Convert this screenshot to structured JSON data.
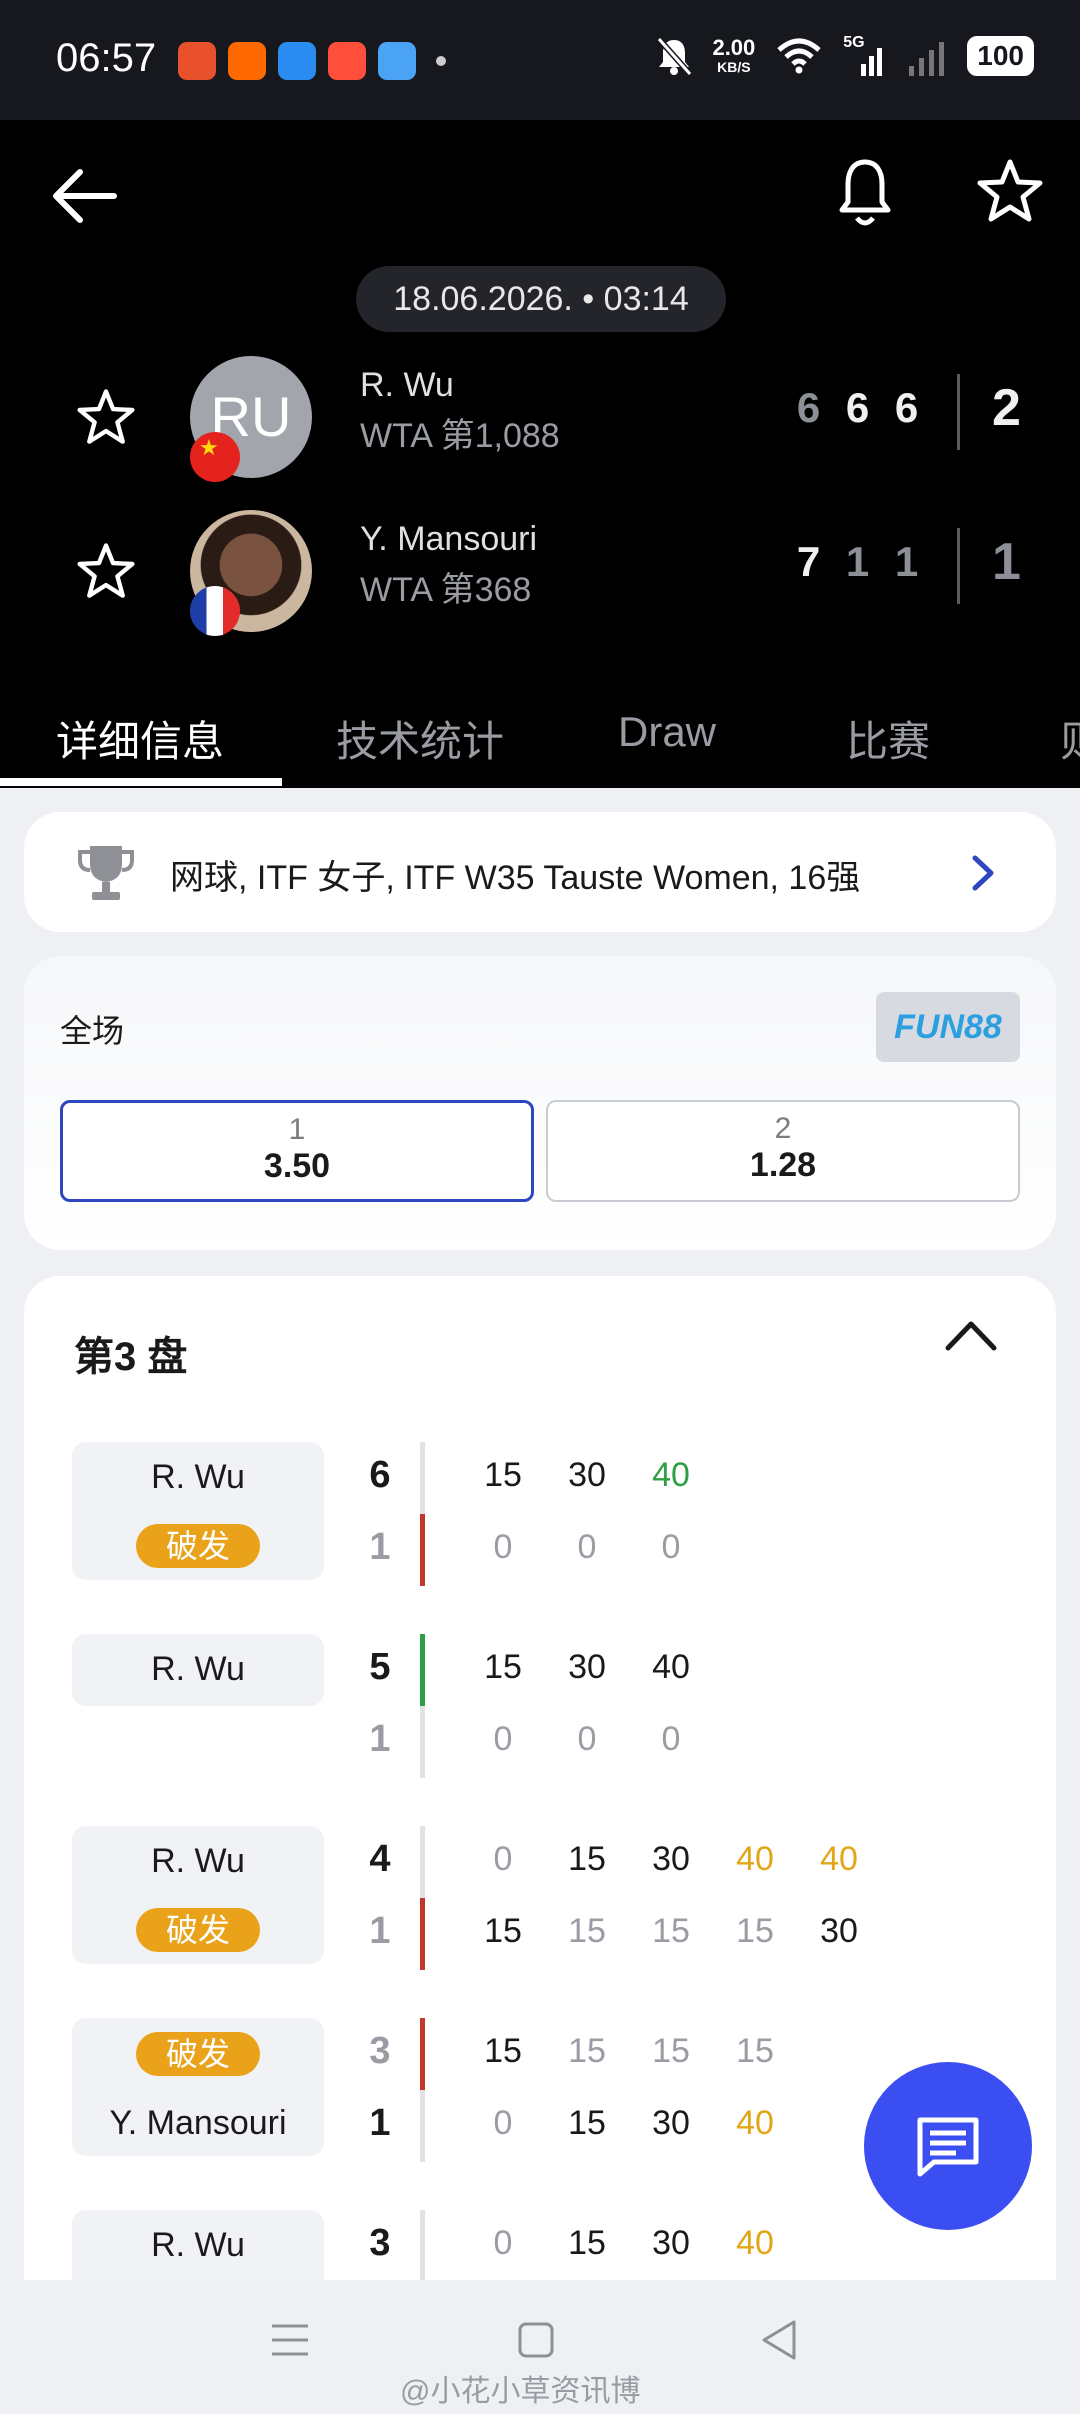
{
  "status_bar": {
    "time": "06:57",
    "speed_value": "2.00",
    "speed_unit": "KB/S",
    "network": "5G",
    "battery": "100",
    "app_icon_colors": [
      "#e8512c",
      "#ff6a00",
      "#2a8cf0",
      "#ff4e3a",
      "#4ba3f5"
    ]
  },
  "header": {
    "back_icon": "arrow-left-icon",
    "bell_icon": "bell-icon",
    "favorite_icon": "star-outline-icon",
    "match_datetime": "18.06.2026. • 03:14"
  },
  "players": [
    {
      "initials": "RU",
      "name": "R. Wu",
      "rank": "WTA 第1,088",
      "flag": "china-flag-icon",
      "sets": [
        "6",
        "6",
        "6"
      ],
      "total": "2"
    },
    {
      "initials": "",
      "name": "Y. Mansouri",
      "rank": "WTA 第368",
      "flag": "france-flag-icon",
      "sets": [
        "7",
        "1",
        "1"
      ],
      "total": "1"
    }
  ],
  "tabs": [
    "详细信息",
    "技术统计",
    "Draw",
    "比赛",
    "则"
  ],
  "tournament": {
    "text": "网球, ITF 女子, ITF W35 Tauste Women, 16强"
  },
  "odds": {
    "title": "全场",
    "bookmaker": "FUN88",
    "options": [
      {
        "label": "1",
        "value": "3.50"
      },
      {
        "label": "2",
        "value": "1.28"
      }
    ]
  },
  "set_section": {
    "title": "第3 盘",
    "games": [
      {
        "label_top": "R. Wu",
        "badge": "破发",
        "score_top": "6",
        "score_bottom": "1",
        "points_top": [
          "15",
          "30",
          "40"
        ],
        "points_bottom": [
          "0",
          "0",
          "0"
        ]
      },
      {
        "label_top": "R. Wu",
        "score_top": "5",
        "score_bottom": "1",
        "points_top": [
          "15",
          "30",
          "40"
        ],
        "points_bottom": [
          "0",
          "0",
          "0"
        ]
      },
      {
        "label_top": "R. Wu",
        "badge": "破发",
        "score_top": "4",
        "score_bottom": "1",
        "points_top": [
          "0",
          "15",
          "30",
          "40",
          "40"
        ],
        "points_bottom": [
          "15",
          "15",
          "15",
          "15",
          "30"
        ]
      },
      {
        "badge": "破发",
        "label_bottom": "Y. Mansouri",
        "score_top": "3",
        "score_bottom": "1",
        "points_top": [
          "15",
          "15",
          "15",
          "15"
        ],
        "points_bottom": [
          "0",
          "15",
          "30",
          "40"
        ]
      },
      {
        "label_top": "R. Wu",
        "score_top": "3",
        "points_top": [
          "0",
          "15",
          "30",
          "40"
        ]
      }
    ]
  },
  "colors": {
    "break_badge": "#e9a21a",
    "green_point": "#2ea043",
    "gold_point": "#e3a619",
    "red_marker": "#c0392b",
    "green_marker": "#2ea043",
    "fab": "#3a4ef2",
    "odds_selected_border": "#2d47c0"
  },
  "watermark": "@小花小草资讯博"
}
